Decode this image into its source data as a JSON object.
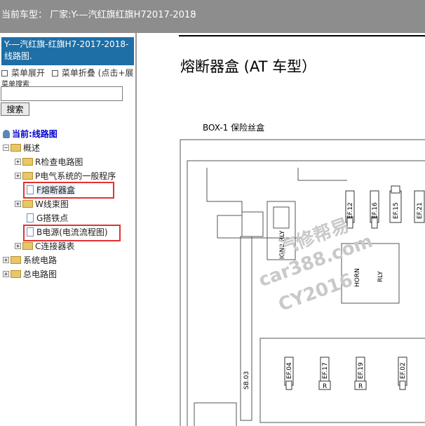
{
  "topbar": {
    "title": "当前车型： 厂家:Y-—汽红旗红旗H72017-2018",
    "dot": "."
  },
  "sidebar": {
    "model_title": "Y-—汽红旗-红旗H7-2017-2018- 线路图.",
    "menu_expand": "菜单展开",
    "menu_collapse": "菜单折叠 (点击+展",
    "search_label": "菜单搜索",
    "search_value": "",
    "search_button": "搜索",
    "current_label": "当前:线路图",
    "tree": [
      {
        "label": "概述"
      },
      {
        "label": "R检查电路图"
      },
      {
        "label": "P电气系统的一般程序"
      },
      {
        "label": "F熔断器盒"
      },
      {
        "label": "W线束图"
      },
      {
        "label": "G搭铁点"
      },
      {
        "label": "B电源(电流流程图)"
      },
      {
        "label": "C连接器表"
      },
      {
        "label": "系统电路"
      },
      {
        "label": "总电路图"
      }
    ]
  },
  "main": {
    "title": "熔断器盒 (AT 车型）",
    "box_label": "BOX-1  保险丝盒",
    "diagram": {
      "fuses_top": [
        "EF.12",
        "EF.16",
        "EF.15",
        "EF.21"
      ],
      "relay_ign": "IGN2 RLY",
      "relay_horn": "HORN",
      "relay_label": "RLY",
      "sb": "SB.03",
      "fuses_bottom": [
        "EF.04",
        "EF.17",
        "EF.19",
        "EF.02"
      ],
      "r_mark": "R"
    },
    "watermark": [
      "汽修帮易",
      "car388.com",
      "CY2016"
    ]
  }
}
